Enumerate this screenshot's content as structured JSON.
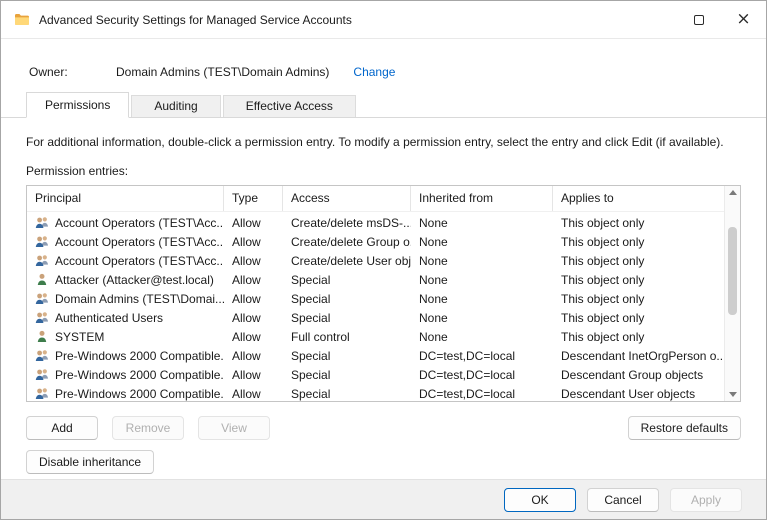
{
  "window": {
    "title": "Advanced Security Settings for Managed Service Accounts"
  },
  "owner": {
    "label": "Owner:",
    "value": "Domain Admins (TEST\\Domain Admins)",
    "change_link": "Change"
  },
  "tabs": {
    "permissions": "Permissions",
    "auditing": "Auditing",
    "effective_access": "Effective Access"
  },
  "info_text": "For additional information, double-click a permission entry. To modify a permission entry, select the entry and click Edit (if available).",
  "entries_label": "Permission entries:",
  "table": {
    "columns": [
      "Principal",
      "Type",
      "Access",
      "Inherited from",
      "Applies to"
    ],
    "rows": [
      {
        "icon": "group",
        "principal": "Account Operators (TEST\\Acc...",
        "type": "Allow",
        "access": "Create/delete msDS-...",
        "inherited_from": "None",
        "applies_to": "This object only"
      },
      {
        "icon": "group",
        "principal": "Account Operators (TEST\\Acc...",
        "type": "Allow",
        "access": "Create/delete Group o...",
        "inherited_from": "None",
        "applies_to": "This object only"
      },
      {
        "icon": "group",
        "principal": "Account Operators (TEST\\Acc...",
        "type": "Allow",
        "access": "Create/delete User obj...",
        "inherited_from": "None",
        "applies_to": "This object only"
      },
      {
        "icon": "user",
        "principal": "Attacker (Attacker@test.local)",
        "type": "Allow",
        "access": "Special",
        "inherited_from": "None",
        "applies_to": "This object only"
      },
      {
        "icon": "group",
        "principal": "Domain Admins (TEST\\Domai...",
        "type": "Allow",
        "access": "Special",
        "inherited_from": "None",
        "applies_to": "This object only"
      },
      {
        "icon": "group",
        "principal": "Authenticated Users",
        "type": "Allow",
        "access": "Special",
        "inherited_from": "None",
        "applies_to": "This object only"
      },
      {
        "icon": "user",
        "principal": "SYSTEM",
        "type": "Allow",
        "access": "Full control",
        "inherited_from": "None",
        "applies_to": "This object only"
      },
      {
        "icon": "group",
        "principal": "Pre-Windows 2000 Compatible...",
        "type": "Allow",
        "access": "Special",
        "inherited_from": "DC=test,DC=local",
        "applies_to": "Descendant InetOrgPerson o..."
      },
      {
        "icon": "group",
        "principal": "Pre-Windows 2000 Compatible...",
        "type": "Allow",
        "access": "Special",
        "inherited_from": "DC=test,DC=local",
        "applies_to": "Descendant Group objects"
      },
      {
        "icon": "group",
        "principal": "Pre-Windows 2000 Compatible...",
        "type": "Allow",
        "access": "Special",
        "inherited_from": "DC=test,DC=local",
        "applies_to": "Descendant User objects"
      }
    ]
  },
  "buttons": {
    "add": "Add",
    "remove": "Remove",
    "view": "View",
    "restore_defaults": "Restore defaults",
    "disable_inheritance": "Disable inheritance",
    "ok": "OK",
    "cancel": "Cancel",
    "apply": "Apply"
  },
  "colors": {
    "accent": "#0067c0",
    "link": "#0066cc"
  }
}
